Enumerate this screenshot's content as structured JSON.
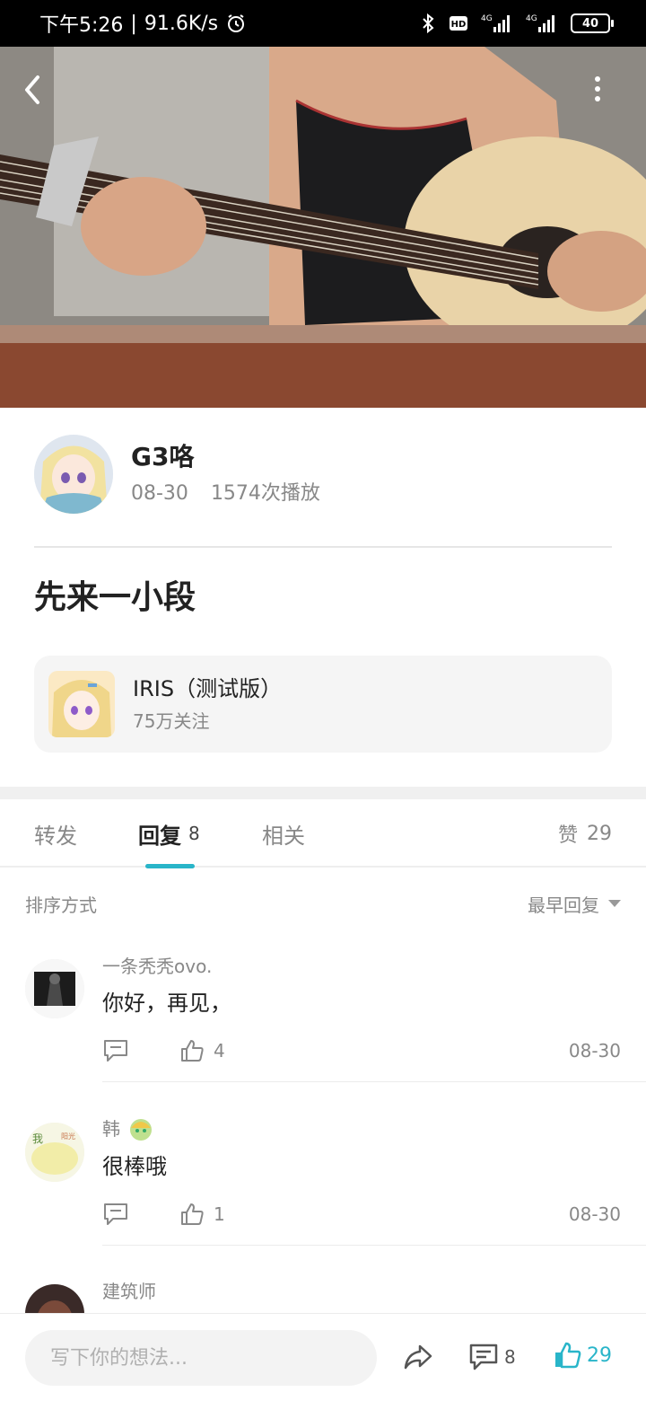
{
  "status_bar": {
    "time": "下午5:26",
    "network_speed": "91.6K/s",
    "battery": "40"
  },
  "author": {
    "name": "G3咯",
    "date": "08-30",
    "plays": "1574次播放"
  },
  "post": {
    "title": "先来一小段"
  },
  "community": {
    "name": "IRIS（测试版）",
    "followers": "75万关注"
  },
  "tabs": {
    "forward": "转发",
    "reply": "回复",
    "reply_count": "8",
    "related": "相关",
    "likes_label": "赞",
    "likes_count": "29"
  },
  "sort": {
    "label": "排序方式",
    "selected": "最早回复"
  },
  "comments": [
    {
      "author": "一条秃秃ovo.",
      "text": "你好，再见，",
      "likes": "4",
      "date": "08-30"
    },
    {
      "author": "韩",
      "text": "很棒哦",
      "likes": "1",
      "date": "08-30"
    },
    {
      "author": "建筑师"
    }
  ],
  "bottom_bar": {
    "input_placeholder": "写下你的想法...",
    "comment_count": "8",
    "like_count": "29"
  },
  "colors": {
    "accent": "#29b5c9",
    "text_primary": "#222222",
    "text_secondary": "#888888"
  }
}
